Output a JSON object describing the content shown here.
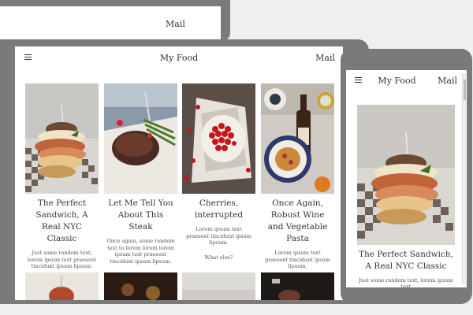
{
  "desktop": {
    "mail_label": "Mail"
  },
  "tablet": {
    "brand": "My Food",
    "mail_label": "Mail",
    "cards": [
      {
        "title": "The Perfect Sandwich, A Real NYC Classic",
        "text": "Just some random text, lorem ipsum text praesent tincidunt ipsum lipsum.",
        "extra": ""
      },
      {
        "title": "Let Me Tell You About This Steak",
        "text": "Once again, some random text to lorem lorem lorem ipsum text praesent tincidunt ipsum lipsum.",
        "extra": ""
      },
      {
        "title": "Cherries, interrupted",
        "text": "Lorem ipsum text praesent tincidunt ipsum lipsum.",
        "extra": "What else?"
      },
      {
        "title": "Once Again, Robust Wine and Vegetable Pasta",
        "text": "Lorem ipsum text praesent tincidunt ipsum lipsum.",
        "extra": ""
      }
    ]
  },
  "phone": {
    "brand": "My Food",
    "mail_label": "Mail",
    "card": {
      "title": "The Perfect Sandwich, A Real NYC Classic",
      "text": "Just some random text, lorem ipsum text"
    }
  },
  "colors": {
    "background": "#efefef",
    "device_frame": "#7a7a7a",
    "screen": "#ffffff",
    "text": "#333333"
  }
}
